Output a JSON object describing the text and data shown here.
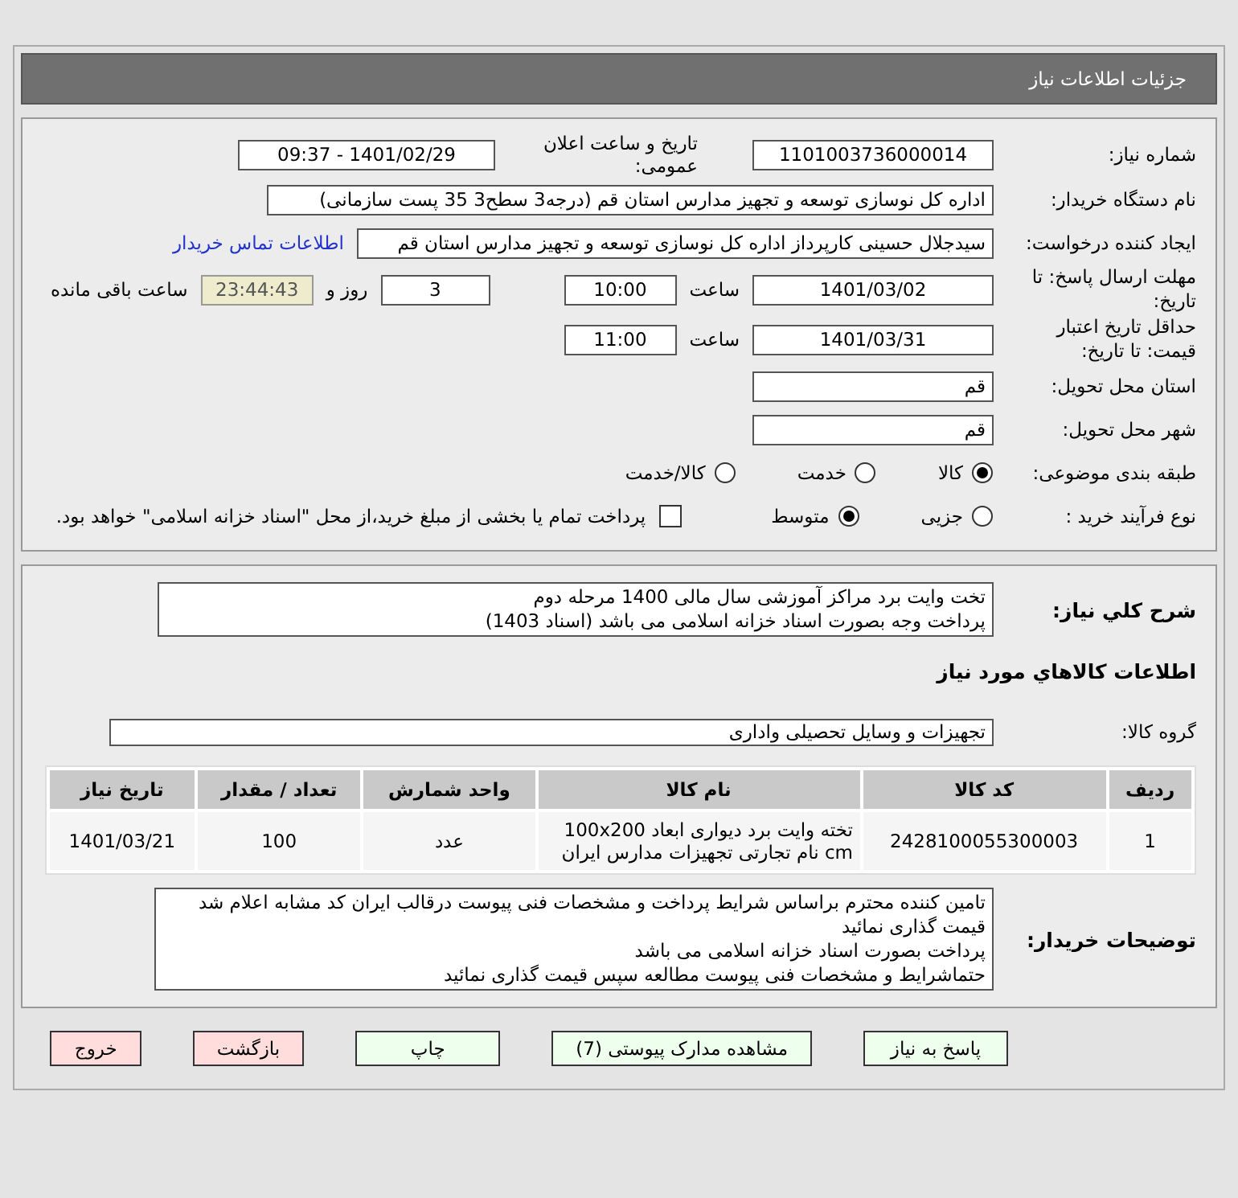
{
  "header": {
    "title": "جزئیات اطلاعات نیاز"
  },
  "info": {
    "need_number": {
      "label": "شماره نیاز:",
      "value": "1101003736000014"
    },
    "announce": {
      "label": "تاریخ و ساعت اعلان عمومی:",
      "value": "1401/02/29 - 09:37"
    },
    "buyer": {
      "label": "نام دستگاه خریدار:",
      "value": "اداره کل نوسازی   توسعه و تجهیز مدارس استان قم (درجه3 سطح3  35 پست سازمانی)"
    },
    "requester": {
      "label": "ایجاد کننده درخواست:",
      "value": "سیدجلال حسینی کارپرداز اداره کل نوسازی   توسعه و تجهیز مدارس استان قم",
      "link": "اطلاعات تماس خریدار"
    },
    "deadline": {
      "label": "مهلت ارسال پاسخ: تا تاریخ:",
      "date": "1401/03/02",
      "time_label": "ساعت",
      "time": "10:00",
      "days": "3",
      "days_label": "روز و",
      "remaining": "23:44:43",
      "remaining_label": "ساعت باقی مانده"
    },
    "validity": {
      "label": "حداقل تاریخ اعتبار قیمت: تا تاریخ:",
      "date": "1401/03/31",
      "time_label": "ساعت",
      "time": "11:00"
    },
    "province": {
      "label": "استان محل تحویل:",
      "value": "قم"
    },
    "city": {
      "label": "شهر محل تحویل:",
      "value": "قم"
    },
    "category": {
      "label": "طبقه بندی موضوعی:",
      "options": [
        {
          "label": "کالا",
          "selected": true
        },
        {
          "label": "خدمت",
          "selected": false
        },
        {
          "label": "کالا/خدمت",
          "selected": false
        }
      ]
    },
    "process": {
      "label": "نوع فرآیند خرید :",
      "options": [
        {
          "label": "جزیی",
          "selected": false
        },
        {
          "label": "متوسط",
          "selected": true
        }
      ],
      "treasury": {
        "label": "پرداخت تمام یا بخشی از مبلغ خرید،از محل \"اسناد خزانه اسلامی\" خواهد بود.",
        "checked": false
      }
    }
  },
  "description": {
    "label": "شرح كلي نياز:",
    "lines": [
      "تخت وایت برد مراکز آموزشی سال مالی 1400 مرحله دوم",
      "پرداخت وجه بصورت اسناد خزانه اسلامی می باشد (اسناد 1403)"
    ]
  },
  "goods_title": "اطلاعات كالاهاي مورد نياز",
  "group": {
    "label": "گروه کالا:",
    "value": "تجهیزات و وسایل تحصیلی واداری"
  },
  "table": {
    "columns": [
      "ردیف",
      "کد کالا",
      "نام کالا",
      "واحد شمارش",
      "تعداد / مقدار",
      "تاریخ نیاز"
    ],
    "rows": [
      [
        "1",
        "2428100055300003",
        "تخته وایت برد دیواری ابعاد 100x200 cm نام تجارتی تجهیزات مدارس ایران",
        "عدد",
        "100",
        "1401/03/21"
      ]
    ]
  },
  "buyer_notes": {
    "label": "توضیحات خریدار:",
    "lines": [
      "تامین کننده محترم براساس شرایط پرداخت و مشخصات فنی پیوست درقالب ایران کد مشابه اعلام شد قیمت گذاری نمائید",
      "پرداخت بصورت اسناد خزانه اسلامی می باشد",
      "حتماشرایط و مشخصات فنی پیوست مطالعه سپس قیمت گذاری نمائید"
    ]
  },
  "buttons": [
    {
      "label": "پاسخ به نیاز",
      "kind": "normal"
    },
    {
      "label": "مشاهده مدارک پیوستی (7)",
      "kind": "normal"
    },
    {
      "label": "چاپ",
      "kind": "normal"
    },
    {
      "label": "بازگشت",
      "kind": "exit"
    },
    {
      "label": "خروج",
      "kind": "exit"
    }
  ]
}
